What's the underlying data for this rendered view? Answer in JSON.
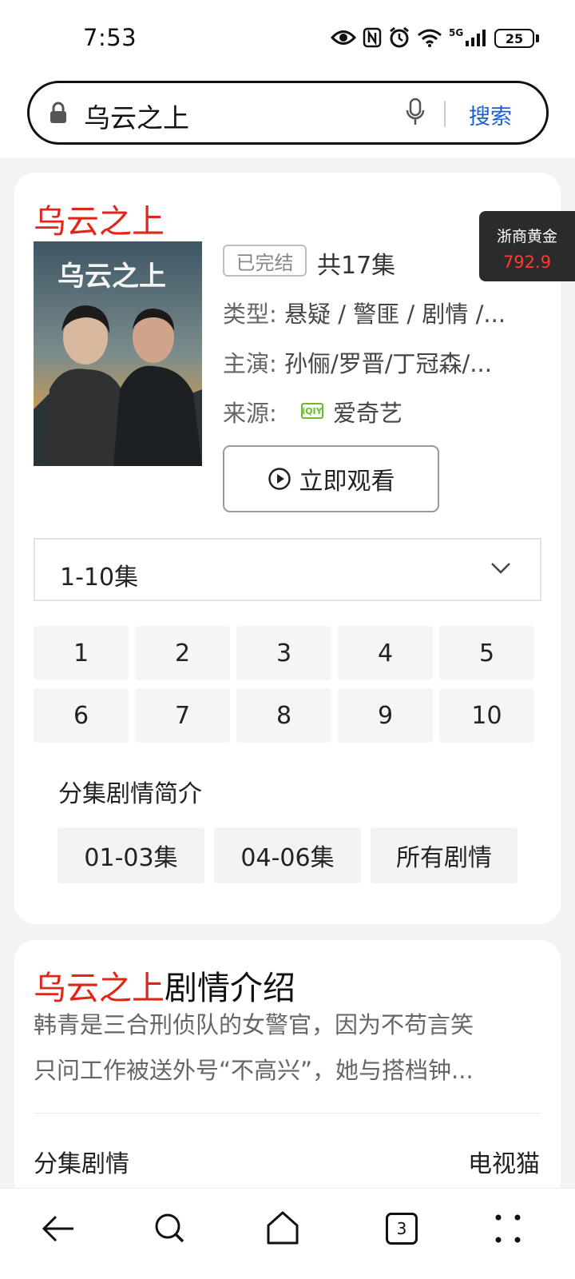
{
  "status_bar": {
    "time": "7:53",
    "network_label": "5G",
    "battery": "25"
  },
  "search": {
    "query": "乌云之上",
    "button_label": "搜索"
  },
  "show": {
    "title": "乌云之上",
    "status_tag": "已完结",
    "episode_total": "共17集",
    "genre_label": "类型:",
    "genre_value": "悬疑 / 警匪 / 剧情 /...",
    "cast_label": "主演:",
    "cast_value": "孙俪/罗晋/丁冠森/...",
    "source_label": "来源:",
    "source_badge": "iQIY",
    "source_name": "爱奇艺",
    "poster_title": "乌云之上",
    "watch_label": "立即观看"
  },
  "episodes": {
    "range_label": "1-10集",
    "numbers": [
      "1",
      "2",
      "3",
      "4",
      "5",
      "6",
      "7",
      "8",
      "9",
      "10"
    ]
  },
  "synopsis": {
    "heading": "分集剧情简介",
    "buttons": [
      "01-03集",
      "04-06集",
      "所有剧情"
    ]
  },
  "float_widget": {
    "label": "浙商黄金",
    "value": "792.9"
  },
  "plot": {
    "title_red": "乌云之上",
    "title_suffix": "剧情介绍",
    "line1": "韩青是三合刑侦队的女警官，因为不苟言笑",
    "line2": "只问工作被送外号“不高兴”，她与搭档钟...",
    "episode_label": "分集剧情",
    "episode_source": "电视猫"
  },
  "bottom_nav": {
    "tab_count": "3"
  },
  "colors": {
    "accent_red": "#e1251b",
    "link_blue": "#1a5fd6",
    "iqiyi_green": "#6fb92d"
  }
}
